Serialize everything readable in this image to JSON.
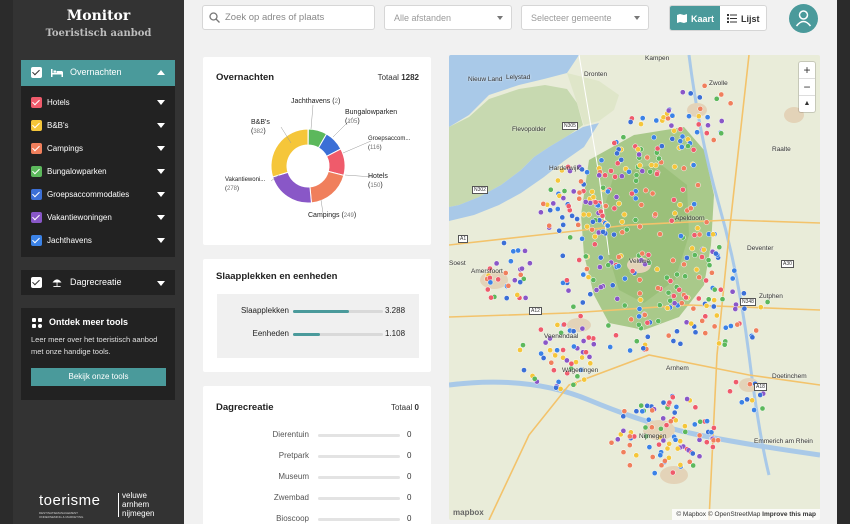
{
  "app": {
    "title": "Monitor",
    "subtitle": "Toeristisch aanbod"
  },
  "sidebar": {
    "overnachten": {
      "label": "Overnachten",
      "checked": true,
      "icon": "bed-icon"
    },
    "categories": [
      {
        "label": "Hotels",
        "color": "#ef5b6b"
      },
      {
        "label": "B&B's",
        "color": "#f5c63a"
      },
      {
        "label": "Campings",
        "color": "#f07f5c"
      },
      {
        "label": "Bungalowparken",
        "color": "#5cb85c"
      },
      {
        "label": "Groepsaccommodaties",
        "color": "#3b6fd6"
      },
      {
        "label": "Vakantiewoningen",
        "color": "#8957c7"
      },
      {
        "label": "Jachthavens",
        "color": "#3b82e6"
      }
    ],
    "dagrecreatie": {
      "label": "Dagrecreatie",
      "checked": true,
      "icon": "beach-umbrella-icon"
    },
    "tools": {
      "title": "Ontdek meer tools",
      "text": "Leer meer over het toeristisch aanbod met onze handige tools.",
      "button": "Bekijk onze tools"
    },
    "logo": {
      "main": "toerisme",
      "right1": "veluwe",
      "right2": "arnhem",
      "right3": "nijmegen",
      "small1": "DESTINATIEMANAGEMENT",
      "small2": "ONDERNEMING & MARKETING"
    }
  },
  "topbar": {
    "search_placeholder": "Zoek op adres of plaats",
    "distance_select": "Alle afstanden",
    "municipality_select": "Selecteer gemeente",
    "view_map": "Kaart",
    "view_list": "Lijst"
  },
  "overnachten_card": {
    "title": "Overnachten",
    "total_label": "Totaal",
    "total_value": "1282",
    "slices": [
      {
        "label": "Jachthavens",
        "value": 2,
        "color": "#3b82e6"
      },
      {
        "label": "Bungalowparken",
        "value": 105,
        "color": "#5cb85c"
      },
      {
        "label": "Groepsaccom...",
        "value": 116,
        "color": "#3b6fd6"
      },
      {
        "label": "Hotels",
        "value": 150,
        "color": "#ef5b6b"
      },
      {
        "label": "Campings",
        "value": 249,
        "color": "#f07f5c"
      },
      {
        "label": "Vakantiewoni...",
        "value": 278,
        "color": "#8957c7"
      },
      {
        "label": "B&B's",
        "value": 382,
        "color": "#f5c63a"
      }
    ]
  },
  "slaap_card": {
    "title": "Slaapplekken en eenheden",
    "rows": [
      {
        "label": "Slaapplekken",
        "value": "3.288",
        "fill": 0.62
      },
      {
        "label": "Eenheden",
        "value": "1.108",
        "fill": 0.3
      }
    ]
  },
  "dag_card": {
    "title": "Dagrecreatie",
    "total_label": "Totaal",
    "total_value": "0",
    "rows": [
      {
        "label": "Dierentuin",
        "value": "0"
      },
      {
        "label": "Pretpark",
        "value": "0"
      },
      {
        "label": "Museum",
        "value": "0"
      },
      {
        "label": "Zwembad",
        "value": "0"
      },
      {
        "label": "Bioscoop",
        "value": "0"
      }
    ]
  },
  "map": {
    "towns": [
      "Lelystad",
      "Dronten",
      "Kampen",
      "Zwolle",
      "Nieuw Land",
      "Flevopolder",
      "Harderwijk",
      "Raalte",
      "Apeldoorn",
      "Deventer",
      "Amersfoort",
      "Soest",
      "Veluwe",
      "Veenendaal",
      "Wageningen",
      "Arnhem",
      "Nijmegen",
      "Doetinchem",
      "Emmerich am Rhein",
      "Zutphen"
    ],
    "roads": [
      "N305",
      "N302",
      "A1",
      "A12",
      "A18",
      "N348",
      "A30"
    ],
    "zoom_in": "+",
    "zoom_out": "−",
    "compass": "▲",
    "attribution_1": "© Mapbox",
    "attribution_2": "© OpenStreetMap",
    "attribution_3": "Improve this map",
    "brand": "mapbox"
  }
}
